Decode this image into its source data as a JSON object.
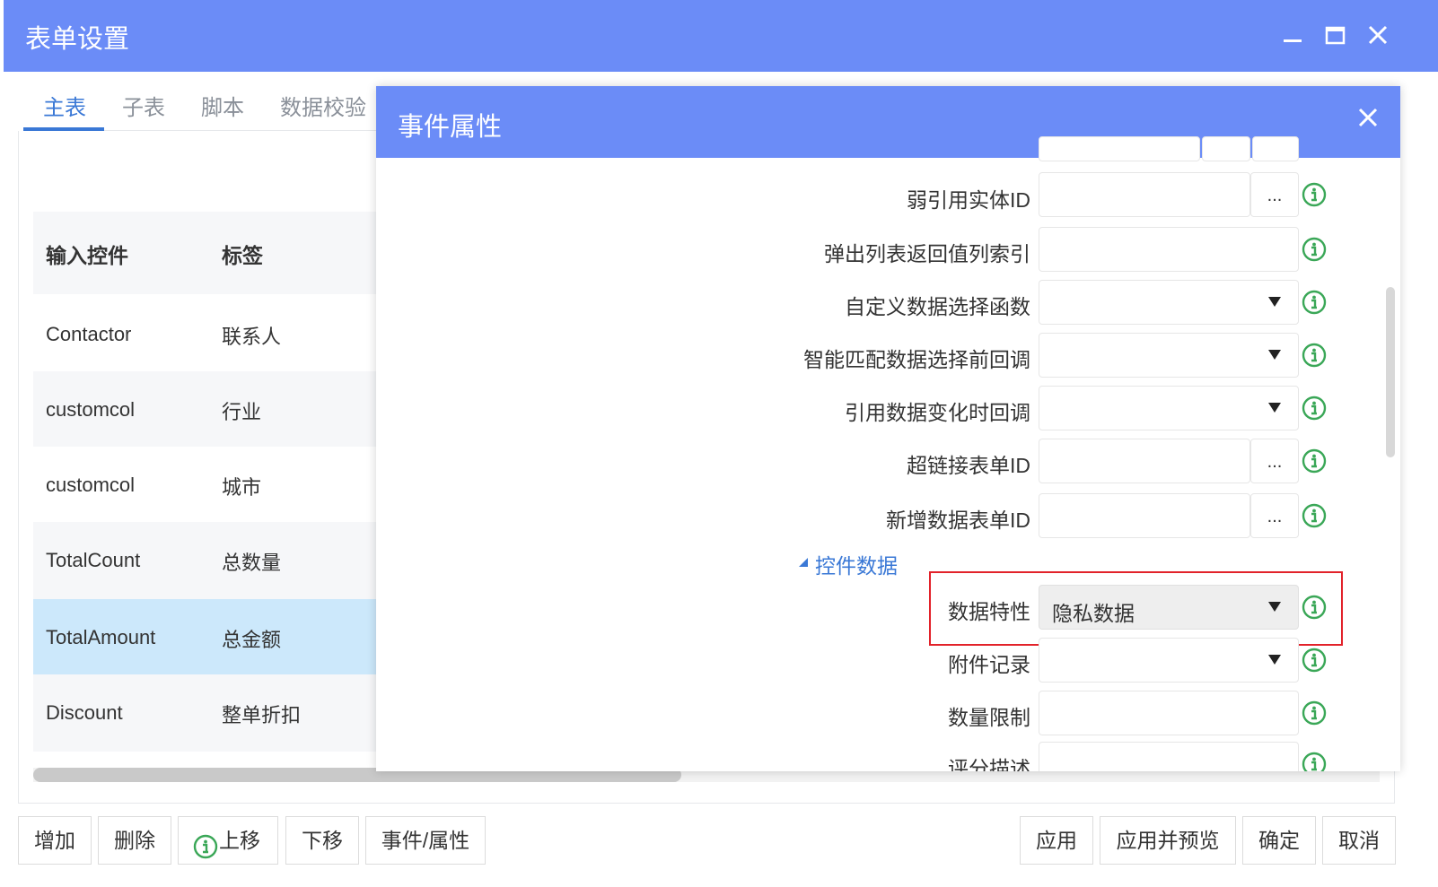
{
  "window": {
    "title": "表单设置"
  },
  "tabs": [
    {
      "label": "主表"
    },
    {
      "label": "子表"
    },
    {
      "label": "脚本"
    },
    {
      "label": "数据校验"
    }
  ],
  "grid": {
    "headers": {
      "control": "输入控件",
      "label": "标签"
    },
    "rows": [
      {
        "control": "Contactor",
        "label": "联系人"
      },
      {
        "control": "customcol",
        "label": "行业"
      },
      {
        "control": "customcol",
        "label": "城市"
      },
      {
        "control": "TotalCount",
        "label": "总数量"
      },
      {
        "control": "TotalAmount",
        "label": "总金额"
      },
      {
        "control": "Discount",
        "label": "整单折扣"
      }
    ]
  },
  "dialog": {
    "title": "事件属性",
    "fields": [
      {
        "label": "弱引用实体ID",
        "value": "",
        "type": "dots"
      },
      {
        "label": "弹出列表返回值列索引",
        "value": "",
        "type": "text"
      },
      {
        "label": "自定义数据选择函数",
        "value": "",
        "type": "select"
      },
      {
        "label": "智能匹配数据选择前回调",
        "value": "",
        "type": "select"
      },
      {
        "label": "引用数据变化时回调",
        "value": "",
        "type": "select"
      },
      {
        "label": "超链接表单ID",
        "value": "",
        "type": "dots"
      },
      {
        "label": "新增数据表单ID",
        "value": "",
        "type": "dots"
      }
    ],
    "section": {
      "label": "控件数据"
    },
    "section_fields": [
      {
        "label": "数据特性",
        "value": "隐私数据",
        "type": "select"
      },
      {
        "label": "附件记录",
        "value": "",
        "type": "select"
      },
      {
        "label": "数量限制",
        "value": "",
        "type": "text"
      },
      {
        "label": "评分描述",
        "value": "",
        "type": "text"
      }
    ],
    "dots_label": "..."
  },
  "footer": {
    "left": [
      "增加",
      "删除",
      "上移",
      "下移",
      "事件/属性"
    ],
    "right": [
      "应用",
      "应用并预览",
      "确定",
      "取消"
    ]
  },
  "colors": {
    "titlebar": "#6b8cf7",
    "tab_active": "#3a78d6",
    "selected_row": "#cce8fb",
    "highlight_border": "#e2222a",
    "info_icon": "#3aa757"
  }
}
